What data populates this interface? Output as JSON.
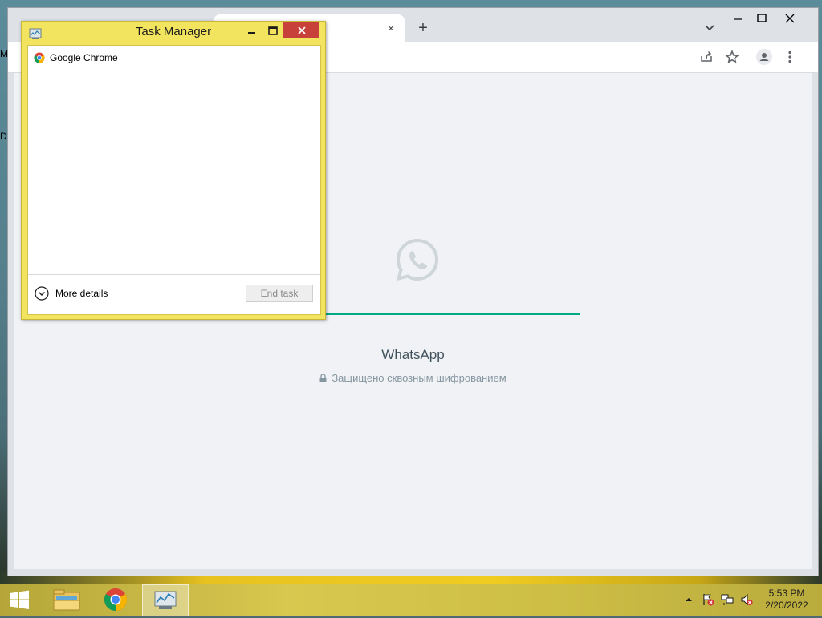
{
  "desktop": {
    "frag_top": "M",
    "frag_mid": "D"
  },
  "browser": {
    "tab_close_label": "×",
    "new_tab_label": "+",
    "page": {
      "title": "WhatsApp",
      "subtitle": "Защищено сквозным шифрованием",
      "progress": 1.0,
      "accent": "#00a884"
    }
  },
  "task_manager": {
    "title": "Task Manager",
    "items": [
      {
        "name": "Google Chrome",
        "icon": "chrome-icon"
      }
    ],
    "more_details": "More details",
    "end_task": "End task",
    "colors": {
      "frame": "#f2e45f",
      "close": "#c7403a"
    }
  },
  "taskbar": {
    "pinned": [
      "file-explorer-icon",
      "chrome-icon",
      "task-manager-icon"
    ],
    "clock_time": "5:53 PM",
    "clock_date": "2/20/2022"
  }
}
